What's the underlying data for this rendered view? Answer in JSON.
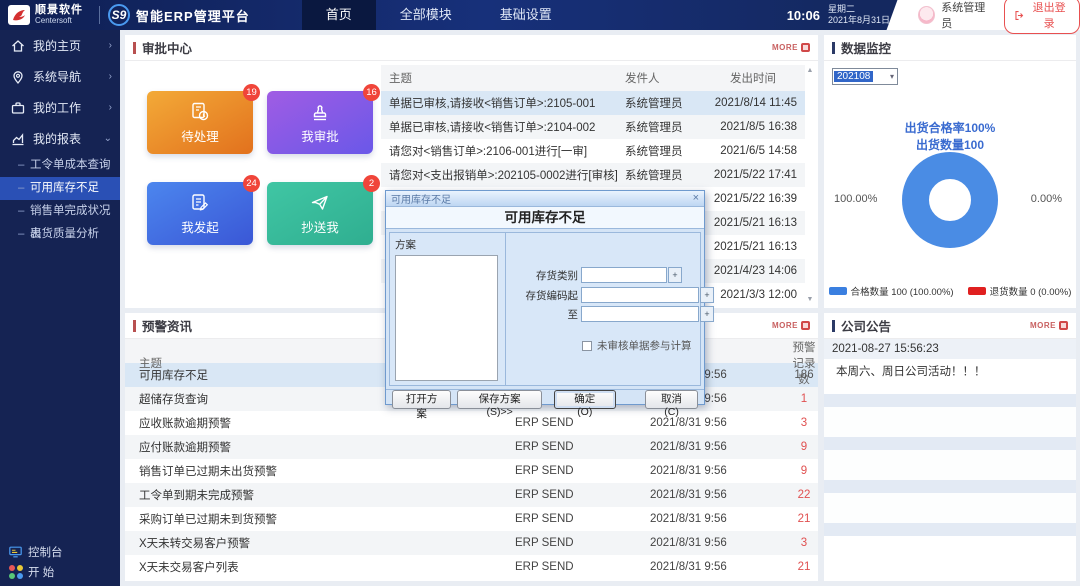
{
  "topbar": {
    "brand_cn": "顺景软件",
    "brand_en": "Centersoft",
    "product": "S9",
    "platform": "智能ERP管理平台",
    "nav": [
      {
        "label": "首页",
        "active": true
      },
      {
        "label": "全部模块",
        "active": false
      },
      {
        "label": "基础设置",
        "active": false
      }
    ],
    "time": "10:06",
    "weekday": "星期二",
    "date": "2021年8月31日",
    "username": "系统管理员",
    "logout_label": "退出登录"
  },
  "sidebar": {
    "items": [
      {
        "label": "我的主页"
      },
      {
        "label": "系统导航"
      },
      {
        "label": "我的工作"
      },
      {
        "label": "我的报表"
      }
    ],
    "report_children": [
      {
        "label": "工令单成本查询"
      },
      {
        "label": "可用库存不足",
        "active": true
      },
      {
        "label": "销售单完成状况表"
      },
      {
        "label": "出货质量分析"
      }
    ],
    "console_label": "控制台",
    "start_label": "开 始"
  },
  "approval": {
    "title": "审批中心",
    "more_label": "MORE",
    "tiles": [
      {
        "label": "待处理",
        "count": "19",
        "icon": "clock-document-icon"
      },
      {
        "label": "我审批",
        "count": "16",
        "icon": "stamp-icon"
      },
      {
        "label": "我发起",
        "count": "24",
        "icon": "compose-icon"
      },
      {
        "label": "抄送我",
        "count": "2",
        "icon": "paper-plane-icon"
      }
    ],
    "headers": {
      "subject": "主题",
      "sender": "发件人",
      "time": "发出时间"
    },
    "rows": [
      {
        "subject": "单据已审核,请接收<销售订单>:2105-001",
        "sender": "系统管理员",
        "time": "2021/8/14 11:45"
      },
      {
        "subject": "单据已审核,请接收<销售订单>:2104-002",
        "sender": "系统管理员",
        "time": "2021/8/5 16:38"
      },
      {
        "subject": "请您对<销售订单>:2106-001进行[一审]",
        "sender": "系统管理员",
        "time": "2021/6/5 14:58"
      },
      {
        "subject": "请您对<支出报销单>:202105-0002进行[审核]",
        "sender": "系统管理员",
        "time": "2021/5/22 17:41"
      },
      {
        "subject": "",
        "sender": "系统管理员",
        "time": "2021/5/22 16:39"
      },
      {
        "subject": "",
        "sender": "系统管理员",
        "time": "2021/5/21 16:13"
      },
      {
        "subject": "",
        "sender": "系统管理员",
        "time": "2021/5/21 16:13"
      },
      {
        "subject": "",
        "sender": "系统管理员",
        "time": "2021/4/23 14:06"
      },
      {
        "subject": "",
        "sender": "系统管理员",
        "time": "2021/3/3 12:00"
      }
    ]
  },
  "alerts": {
    "title": "预警资讯",
    "more_label": "MORE",
    "headers": {
      "subject": "主题",
      "count": "预警记录数"
    },
    "rows": [
      {
        "subject": "可用库存不足",
        "sender": "ERP SEND",
        "time": "2021/8/31 9:56",
        "count": "186"
      },
      {
        "subject": "超储存货查询",
        "sender": "ERP SEND",
        "time": "2021/8/31 9:56",
        "count": "1"
      },
      {
        "subject": "应收账款逾期预警",
        "sender": "ERP SEND",
        "time": "2021/8/31 9:56",
        "count": "3"
      },
      {
        "subject": "应付账款逾期预警",
        "sender": "ERP SEND",
        "time": "2021/8/31 9:56",
        "count": "9"
      },
      {
        "subject": "销售订单已过期未出货预警",
        "sender": "ERP SEND",
        "time": "2021/8/31 9:56",
        "count": "9"
      },
      {
        "subject": "工令单到期未完成预警",
        "sender": "ERP SEND",
        "time": "2021/8/31 9:56",
        "count": "22"
      },
      {
        "subject": "采购订单已过期未到货预警",
        "sender": "ERP SEND",
        "time": "2021/8/31 9:56",
        "count": "21"
      },
      {
        "subject": "X天未转交易客户预警",
        "sender": "ERP SEND",
        "time": "2021/8/31 9:56",
        "count": "3"
      },
      {
        "subject": "X天未交易客户列表",
        "sender": "ERP SEND",
        "time": "2021/8/31 9:56",
        "count": "21"
      }
    ]
  },
  "monitor": {
    "title": "数据监控",
    "period": "202108",
    "line1": "出货合格率100%",
    "line2": "出货数量100",
    "left_label": "100.00%",
    "right_label": "0.00%",
    "legend": [
      {
        "label": "合格数量 100 (100.00%)",
        "color": "#3a7fe0"
      },
      {
        "label": "退货数量 0 (0.00%)",
        "color": "#e02020"
      }
    ],
    "chart_data": {
      "type": "pie",
      "labels": [
        "合格数量",
        "退货数量"
      ],
      "values": [
        100,
        0
      ],
      "percents": [
        "100.00%",
        "0.00%"
      ],
      "colors": [
        "#4a8ce4",
        "#e02020"
      ],
      "legend_position": "bottom"
    }
  },
  "announcement": {
    "title": "公司公告",
    "more_label": "MORE",
    "date": "2021-08-27 15:56:23",
    "content": "本周六、周日公司活动！！！"
  },
  "modal": {
    "window_title": "可用库存不足",
    "title": "可用库存不足",
    "close_glyph": "×",
    "scheme_label": "方案",
    "fields": [
      {
        "label": "存货类别"
      },
      {
        "label": "存货编码起"
      },
      {
        "label": "至"
      }
    ],
    "checkbox_label": "未审核单据参与计算",
    "buttons": {
      "open": "打开方案",
      "save": "保存方案(S)>>",
      "ok": "确定(O)",
      "cancel": "取消(C)"
    }
  }
}
